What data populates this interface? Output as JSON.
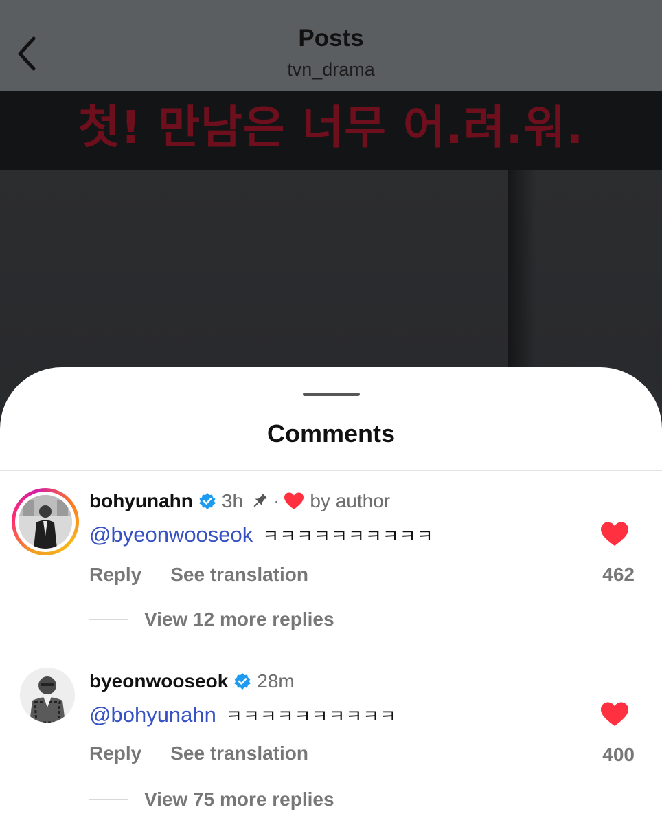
{
  "header": {
    "title": "Posts",
    "subtitle": "tvn_drama"
  },
  "post": {
    "caption_overlay": "첫! 만남은 너무 어.려.워."
  },
  "sheet": {
    "title": "Comments"
  },
  "comments": [
    {
      "username": "bohyunahn",
      "verified": true,
      "time": "3h",
      "pinned": true,
      "liked_by_author_label": "by author",
      "mention": "@byeonwooseok",
      "text": "ㅋㅋㅋㅋㅋㅋㅋㅋㅋㅋ",
      "reply_label": "Reply",
      "translate_label": "See translation",
      "like_count": "462",
      "liked": true,
      "more_replies_label": "View 12 more replies",
      "has_story_ring": true
    },
    {
      "username": "byeonwooseok",
      "verified": true,
      "time": "28m",
      "pinned": false,
      "mention": "@bohyunahn",
      "text": "ㅋㅋㅋㅋㅋㅋㅋㅋㅋㅋ",
      "reply_label": "Reply",
      "translate_label": "See translation",
      "like_count": "400",
      "liked": true,
      "more_replies_label": "View 75 more replies",
      "has_story_ring": false
    }
  ],
  "colors": {
    "like_red": "#ff3040",
    "verified_blue": "#1d9bf0",
    "mention_blue": "#3651c4",
    "caption_red": "#6e0f1d"
  },
  "icons": {
    "back": "chevron-left-icon",
    "verified": "verified-badge-icon",
    "pin": "pin-icon",
    "heart": "heart-icon"
  }
}
